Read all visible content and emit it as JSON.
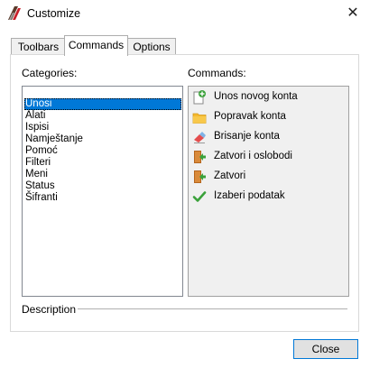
{
  "window": {
    "title": "Customize",
    "icon": "customize-app-icon",
    "close_glyph": "✕"
  },
  "tabs": [
    {
      "label": "Toolbars",
      "active": false
    },
    {
      "label": "Commands",
      "active": true
    },
    {
      "label": "Options",
      "active": false
    }
  ],
  "categories": {
    "label": "Categories:",
    "items": [
      "Unosi",
      "Alati",
      "Ispisi",
      "Namještanje",
      "Pomoć",
      "Filteri",
      "Meni",
      "Status",
      "Šifranti"
    ],
    "selected": "Unosi"
  },
  "commands": {
    "label": "Commands:",
    "items": [
      {
        "label": "Unos novog konta",
        "icon": "new-document-icon"
      },
      {
        "label": "Popravak konta",
        "icon": "folder-icon"
      },
      {
        "label": "Brisanje konta",
        "icon": "eraser-icon"
      },
      {
        "label": "Zatvori i oslobodi",
        "icon": "exit-door-icon"
      },
      {
        "label": "Zatvori",
        "icon": "exit-door-icon"
      },
      {
        "label": "Izaberi podatak",
        "icon": "checkmark-icon"
      }
    ]
  },
  "description": {
    "label": "Description"
  },
  "buttons": {
    "close_label": "Close"
  },
  "colors": {
    "selection": "#0078d7",
    "accent_green": "#3aa13a",
    "folder_yellow": "#f5b82e"
  }
}
